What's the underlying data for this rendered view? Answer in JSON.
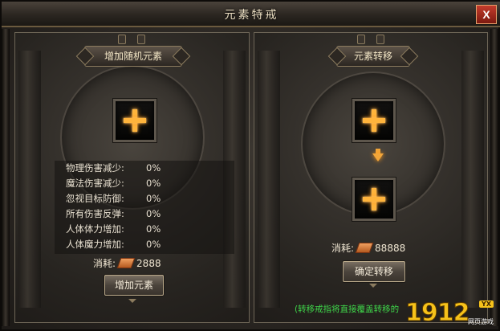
{
  "window": {
    "title": "元素特戒",
    "close_label": "X"
  },
  "left_panel": {
    "header": "增加随机元素",
    "stats": [
      {
        "label": "物理伤害减少:",
        "value": "0%"
      },
      {
        "label": "魔法伤害减少:",
        "value": "0%"
      },
      {
        "label": "忽视目标防御:",
        "value": "0%"
      },
      {
        "label": "所有伤害反弹:",
        "value": "0%"
      },
      {
        "label": "人体体力增加:",
        "value": "0%"
      },
      {
        "label": "人体魔力增加:",
        "value": "0%"
      }
    ],
    "cost_label": "消耗:",
    "cost_value": "2888",
    "button": "增加元素"
  },
  "right_panel": {
    "header": "元素转移",
    "cost_label": "消耗:",
    "cost_value": "88888",
    "button": "确定转移",
    "note": "(转移戒指将直接覆盖转移的"
  },
  "watermark": {
    "number": "1912",
    "badge": "YX",
    "sub": "网页游戏"
  },
  "colors": {
    "accent": "#ffb43c",
    "note": "#3fd64a",
    "close": "#c43c2c"
  }
}
